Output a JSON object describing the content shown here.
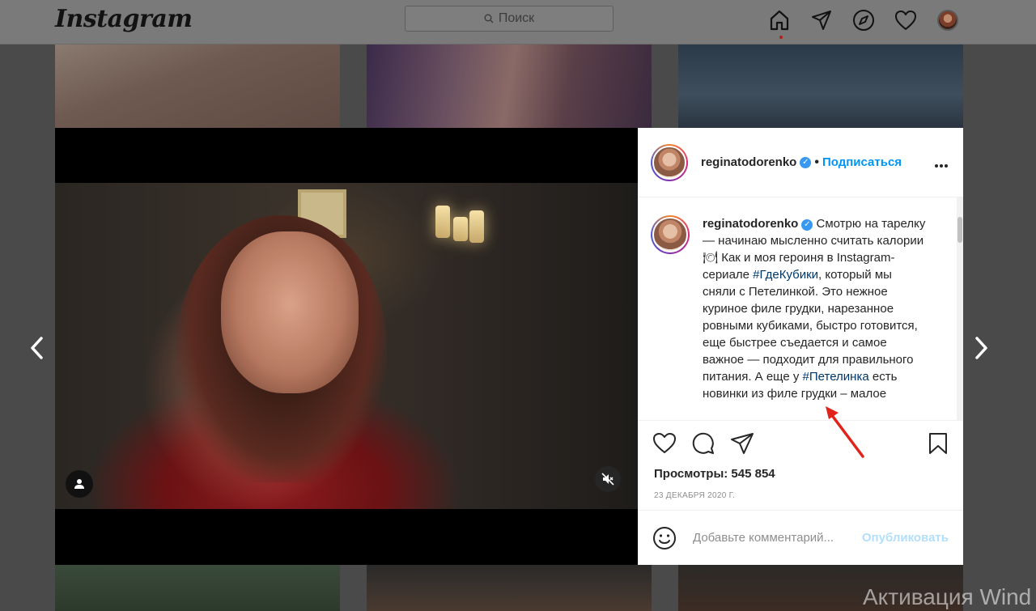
{
  "app": {
    "logo": "Instagram",
    "search_placeholder": "Поиск"
  },
  "post": {
    "username": "reginatodorenko",
    "follow_label": "Подписаться",
    "separator": "•",
    "caption_username": "reginatodorenko",
    "caption_parts": [
      {
        "type": "text",
        "value": " Смотрю на тарелку — начинаю мысленно считать калории 🍽 Как и моя героиня в Instagram-сериале "
      },
      {
        "type": "tag",
        "value": "#ГдеКубики"
      },
      {
        "type": "text",
        "value": ", который мы сняли с Петелинкой. Это нежное куриное филе грудки, нарезанное ровными кубиками, быстро готовится, еще быстрее съедается и самое важное — подходит для правильного питания. А еще у "
      },
      {
        "type": "tag",
        "value": "#Петелинка"
      },
      {
        "type": "text",
        "value": " есть новинки из филе грудки – малое"
      }
    ],
    "views_label": "Просмотры: 545 854",
    "date": "23 ДЕКАБРЯ 2020 Г.",
    "comment_placeholder": "Добавьте комментарий...",
    "publish_label": "Опубликовать"
  },
  "overlay": {
    "watermark": "Активация Wind"
  },
  "colors": {
    "accent": "#0095f6",
    "hashtag": "#00376b",
    "annotation_arrow": "#e0241b",
    "verified": "#3897f0"
  },
  "icons": [
    "home-icon",
    "direct-icon",
    "explore-icon",
    "activity-heart-icon",
    "profile-avatar",
    "prev-arrow-icon",
    "next-arrow-icon",
    "user-tag-icon",
    "mute-icon",
    "like-icon",
    "comment-icon",
    "share-icon",
    "bookmark-icon",
    "emoji-icon",
    "more-icon"
  ]
}
